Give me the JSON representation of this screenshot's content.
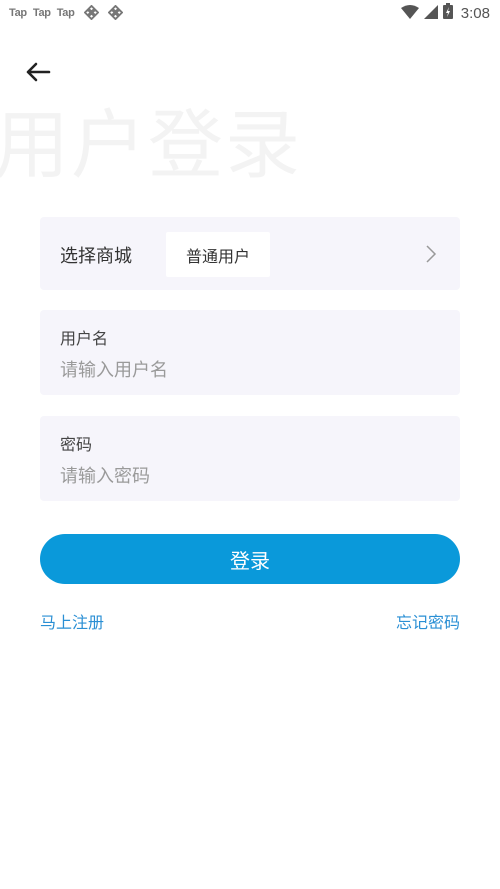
{
  "status_bar": {
    "notifications": [
      "Tap",
      "Tap",
      "Tap"
    ],
    "notification_icons": [
      "sync-icon",
      "sync-icon"
    ],
    "system_icons": [
      "wifi-icon",
      "signal-icon",
      "battery-charging-icon"
    ],
    "time": "3:08"
  },
  "header": {
    "back_icon": "arrow-left-icon",
    "watermark_title": "用户登录"
  },
  "form": {
    "store_selector": {
      "label": "选择商城",
      "value": "普通用户",
      "icon": "chevron-right-icon"
    },
    "username": {
      "label": "用户名",
      "value": "",
      "placeholder": "请输入用户名"
    },
    "password": {
      "label": "密码",
      "value": "",
      "placeholder": "请输入密码"
    },
    "login_button": "登录",
    "register_link": "马上注册",
    "forgot_link": "忘记密码"
  },
  "colors": {
    "accent": "#0a99da",
    "link": "#2a8fd4",
    "card_background": "#f6f5fb"
  }
}
